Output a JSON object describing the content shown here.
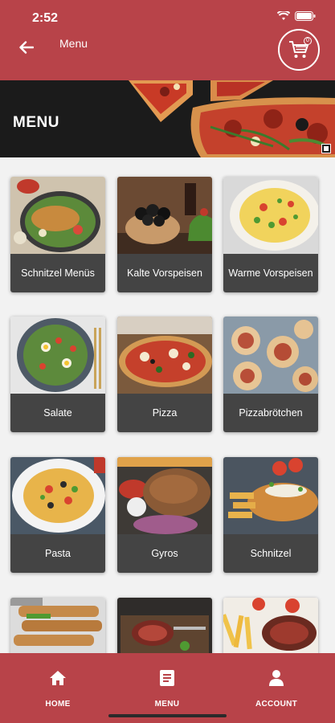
{
  "status_bar": {
    "time": "2:52"
  },
  "header": {
    "title": "Menu",
    "cart_count": "0"
  },
  "banner": {
    "title": "MENU"
  },
  "categories": [
    {
      "label": "Schnitzel Menüs"
    },
    {
      "label": "Kalte Vorspeisen"
    },
    {
      "label": "Warme Vorspeisen"
    },
    {
      "label": "Salate"
    },
    {
      "label": "Pizza"
    },
    {
      "label": "Pizzabrötchen"
    },
    {
      "label": "Pasta"
    },
    {
      "label": "Gyros"
    },
    {
      "label": "Schnitzel"
    },
    {
      "label": ""
    },
    {
      "label": ""
    },
    {
      "label": ""
    }
  ],
  "nav": {
    "home": "HOME",
    "menu": "MENU",
    "account": "ACCOUNT"
  },
  "colors": {
    "brand": "#b84349",
    "card_label_bg": "#444444"
  }
}
